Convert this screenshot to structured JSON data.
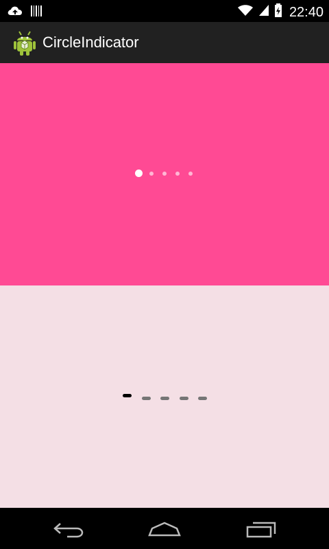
{
  "status_bar": {
    "time": "22:40",
    "icons": [
      "cloud-upload-icon",
      "barcode-icon",
      "wifi-icon",
      "signal-icon",
      "battery-charging-icon"
    ]
  },
  "action_bar": {
    "title": "CircleIndicator",
    "icon": "android-robot-icon"
  },
  "pages": {
    "top_indicator": {
      "count": 5,
      "selected_index": 0,
      "color": "#ffffff",
      "background": "#FF4A94"
    },
    "bottom_indicator": {
      "count": 5,
      "selected_index": 0,
      "active_color": "#000000",
      "inactive_color": "#757575",
      "background": "#F4DFE5"
    }
  },
  "navigation_bar": {
    "buttons": [
      "back-icon",
      "home-icon",
      "recent-apps-icon"
    ]
  }
}
